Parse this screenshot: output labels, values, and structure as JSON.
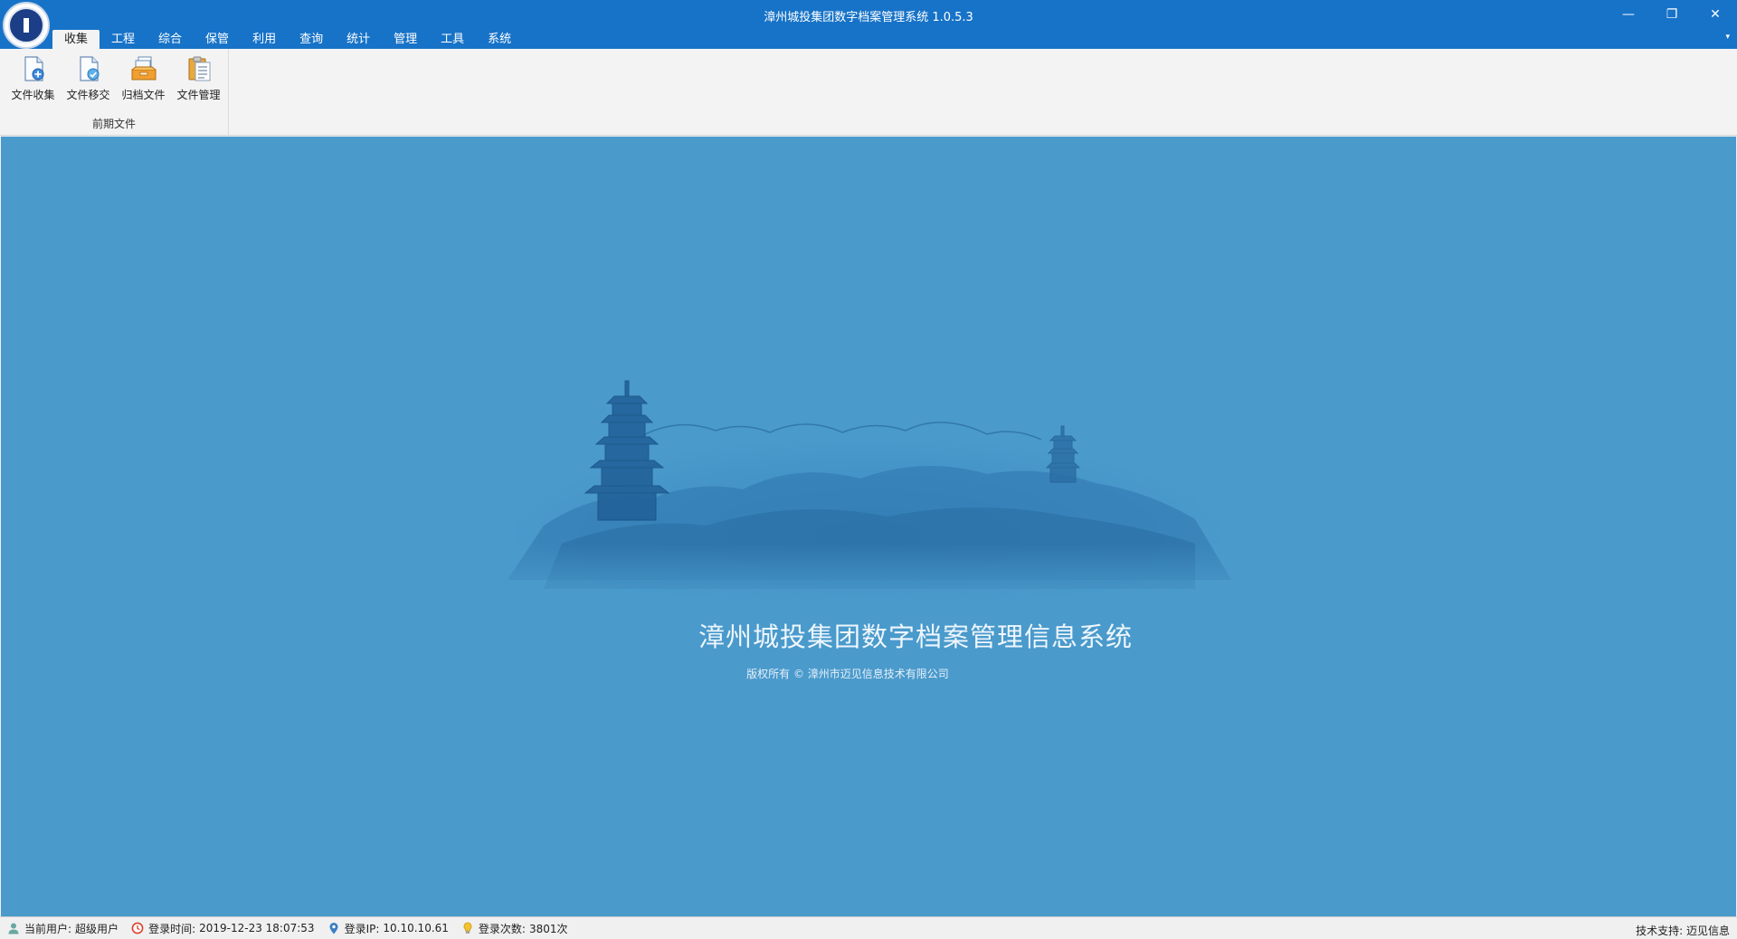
{
  "window": {
    "title": "漳州城投集团数字档案管理系统 1.0.5.3",
    "controls": [
      "minimize-icon",
      "restore-icon",
      "close-icon"
    ]
  },
  "tabs": [
    {
      "label": "收集",
      "active": true
    },
    {
      "label": "工程"
    },
    {
      "label": "综合"
    },
    {
      "label": "保管"
    },
    {
      "label": "利用"
    },
    {
      "label": "查询"
    },
    {
      "label": "统计"
    },
    {
      "label": "管理"
    },
    {
      "label": "工具"
    },
    {
      "label": "系统"
    }
  ],
  "ribbon": {
    "group_label": "前期文件",
    "buttons": [
      {
        "label": "文件收集",
        "icon": "file-add-icon"
      },
      {
        "label": "文件移交",
        "icon": "file-transfer-icon"
      },
      {
        "label": "归档文件",
        "icon": "archive-files-icon"
      },
      {
        "label": "文件管理",
        "icon": "clipboard-icon"
      }
    ]
  },
  "main": {
    "title": "漳州城投集团数字档案管理信息系统",
    "copyright": "版权所有 © 漳州市迈见信息技术有限公司"
  },
  "status": {
    "user_label": "当前用户:",
    "user_value": "超级用户",
    "time_label": "登录时间:",
    "time_value": "2019-12-23 18:07:53",
    "ip_label": "登录IP:",
    "ip_value": "10.10.10.61",
    "count_label": "登录次数:",
    "count_value": "3801次",
    "support": "技术支持: 迈见信息"
  },
  "colors": {
    "titlebar": "#1773c8",
    "background": "#4a9acc"
  }
}
